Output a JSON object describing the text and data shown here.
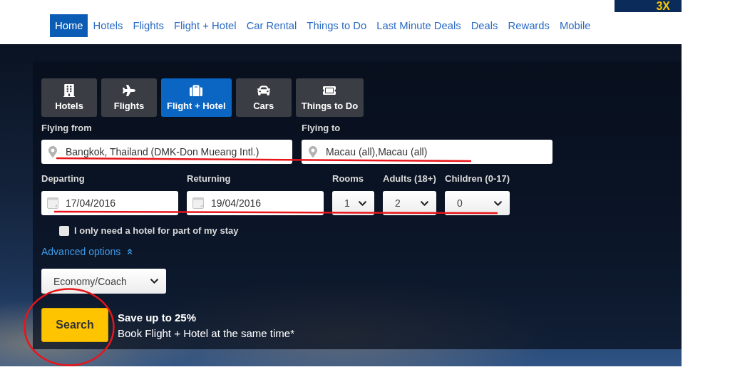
{
  "promo_badge": {
    "text": "3X"
  },
  "nav": [
    {
      "label": "Home",
      "selected": true
    },
    {
      "label": "Hotels",
      "selected": false
    },
    {
      "label": "Flights",
      "selected": false
    },
    {
      "label": "Flight + Hotel",
      "selected": false
    },
    {
      "label": "Car Rental",
      "selected": false
    },
    {
      "label": "Things to Do",
      "selected": false
    },
    {
      "label": "Last Minute Deals",
      "selected": false
    },
    {
      "label": "Deals",
      "selected": false
    },
    {
      "label": "Rewards",
      "selected": false
    },
    {
      "label": "Mobile",
      "selected": false
    }
  ],
  "search_tabs": [
    {
      "kind": "hotel",
      "label": "Hotels",
      "selected": false
    },
    {
      "kind": "flight",
      "label": "Flights",
      "selected": false
    },
    {
      "kind": "package",
      "label": "Flight + Hotel",
      "selected": true
    },
    {
      "kind": "car",
      "label": "Cars",
      "selected": false
    },
    {
      "kind": "activity",
      "label": "Things to Do",
      "selected": false
    }
  ],
  "locations": [
    {
      "label": "Flying from",
      "value": "Bangkok, Thailand (DMK-Don Mueang Intl.)"
    },
    {
      "label": "Flying to",
      "value": "Macau (all),Macau (all)"
    }
  ],
  "dates": [
    {
      "label": "Departing",
      "value": "17/04/2016"
    },
    {
      "label": "Returning",
      "value": "19/04/2016"
    }
  ],
  "travellers": [
    {
      "label": "Rooms",
      "value": "1"
    },
    {
      "label": "Adults (18+)",
      "value": "2"
    },
    {
      "label": "Children (0-17)",
      "value": "0"
    }
  ],
  "partial_hotel": {
    "label": "I only need a hotel for part of my stay",
    "checked": false
  },
  "advanced_options": {
    "label": "Advanced options",
    "expanded": true,
    "cabin_class": "Economy/Coach"
  },
  "search_button": {
    "label": "Search"
  },
  "promo": {
    "headline": "Save up to 25%",
    "text": "Book Flight + Hotel at the same time*"
  }
}
